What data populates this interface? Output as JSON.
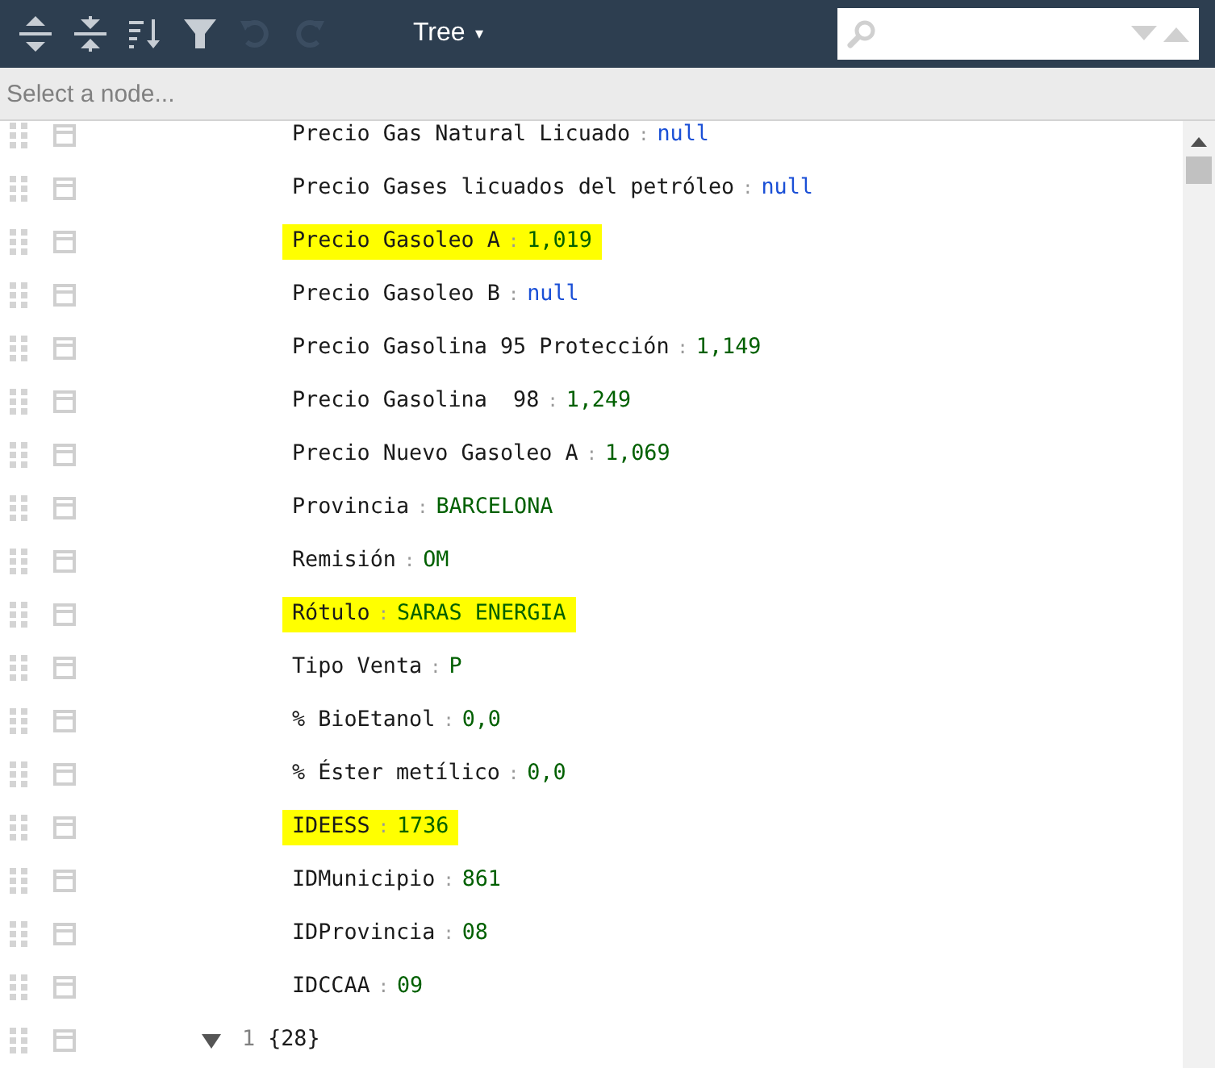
{
  "toolbar": {
    "mode": "Tree",
    "mode_caret": "▾",
    "undo_disabled": true,
    "redo_disabled": true
  },
  "navbar": {
    "placeholder": "Select a node..."
  },
  "rows": [
    {
      "kind": "field",
      "key": "Precio Gas Natural Licuado",
      "separator": ":",
      "value": {
        "kind": "null",
        "text": "null"
      },
      "highlighted": false
    },
    {
      "kind": "field",
      "key": "Precio Gases licuados del petróleo",
      "separator": ":",
      "value": {
        "kind": "null",
        "text": "null"
      },
      "highlighted": false
    },
    {
      "kind": "field",
      "key": "Precio Gasoleo A",
      "separator": ":",
      "value": {
        "kind": "string",
        "text": "1,019"
      },
      "highlighted": true
    },
    {
      "kind": "field",
      "key": "Precio Gasoleo B",
      "separator": ":",
      "value": {
        "kind": "null",
        "text": "null"
      },
      "highlighted": false
    },
    {
      "kind": "field",
      "key": "Precio Gasolina 95 Protección",
      "separator": ":",
      "value": {
        "kind": "string",
        "text": "1,149"
      },
      "highlighted": false
    },
    {
      "kind": "field",
      "key": "Precio Gasolina  98",
      "separator": ":",
      "value": {
        "kind": "string",
        "text": "1,249"
      },
      "highlighted": false
    },
    {
      "kind": "field",
      "key": "Precio Nuevo Gasoleo A",
      "separator": ":",
      "value": {
        "kind": "string",
        "text": "1,069"
      },
      "highlighted": false
    },
    {
      "kind": "field",
      "key": "Provincia",
      "separator": ":",
      "value": {
        "kind": "string",
        "text": "BARCELONA"
      },
      "highlighted": false
    },
    {
      "kind": "field",
      "key": "Remisión",
      "separator": ":",
      "value": {
        "kind": "string",
        "text": "OM"
      },
      "highlighted": false
    },
    {
      "kind": "field",
      "key": "Rótulo",
      "separator": ":",
      "value": {
        "kind": "string",
        "text": "SARAS ENERGIA"
      },
      "highlighted": true
    },
    {
      "kind": "field",
      "key": "Tipo Venta",
      "separator": ":",
      "value": {
        "kind": "string",
        "text": "P"
      },
      "highlighted": false
    },
    {
      "kind": "field",
      "key": "% BioEtanol",
      "separator": ":",
      "value": {
        "kind": "string",
        "text": "0,0"
      },
      "highlighted": false
    },
    {
      "kind": "field",
      "key": "% Éster metílico",
      "separator": ":",
      "value": {
        "kind": "string",
        "text": "0,0"
      },
      "highlighted": false
    },
    {
      "kind": "field",
      "key": "IDEESS",
      "separator": ":",
      "value": {
        "kind": "string",
        "text": "1736"
      },
      "highlighted": true
    },
    {
      "kind": "field",
      "key": "IDMunicipio",
      "separator": ":",
      "value": {
        "kind": "string",
        "text": "861"
      },
      "highlighted": false
    },
    {
      "kind": "field",
      "key": "IDProvincia",
      "separator": ":",
      "value": {
        "kind": "string",
        "text": "08"
      },
      "highlighted": false
    },
    {
      "kind": "field",
      "key": "IDCCAA",
      "separator": ":",
      "value": {
        "kind": "string",
        "text": "09"
      },
      "highlighted": false
    },
    {
      "kind": "object",
      "index": "1",
      "count": "{28}",
      "expanded": true
    }
  ]
}
